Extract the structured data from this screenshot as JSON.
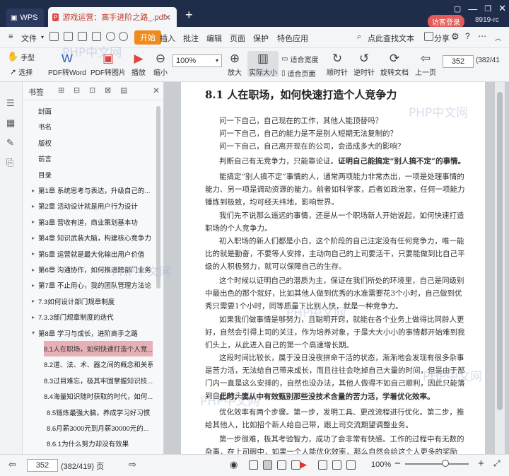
{
  "titlebar": {
    "wps_tab": "WPS",
    "doc_tab": "游戏运营：高手进阶之路_.pdf",
    "login_button": "访客登录",
    "user_id": "8919-rc"
  },
  "menubar": {
    "file": "文件",
    "items": [
      "开始",
      "插入",
      "批注",
      "编辑",
      "页面",
      "保护",
      "特色应用"
    ],
    "search": "点此查找文本",
    "share": "分享"
  },
  "toolbar": {
    "hand": "手型",
    "select": "选择",
    "pdf_to_word": "PDF转Word",
    "pdf_to_image": "PDF转图片",
    "play": "播放",
    "zoom_out": "缩小",
    "zoom_value": "100%",
    "zoom_in": "放大",
    "actual_size": "实际大小",
    "fit_width": "适合宽度",
    "fit_page": "适合页面",
    "rotate_cw": "顺时针",
    "rotate_ccw": "逆时针",
    "rotate_doc": "旋转文档",
    "prev_page": "上一页",
    "page_input": "352",
    "page_total": "(382/41"
  },
  "panel": {
    "title": "书签",
    "bookmarks": [
      {
        "label": "封面",
        "arrow": false
      },
      {
        "label": "书名",
        "arrow": false
      },
      {
        "label": "版权",
        "arrow": false
      },
      {
        "label": "前言",
        "arrow": false
      },
      {
        "label": "目录",
        "arrow": false
      },
      {
        "label": "第1章  系统思考与表达，升级自己的...",
        "arrow": true
      },
      {
        "label": "第2章  活动设计就是用户行为设计",
        "arrow": true
      },
      {
        "label": "第3章  营收有道，商业策划基本功",
        "arrow": true
      },
      {
        "label": "第4章  知识武装大脑，构建核心竞争力",
        "arrow": true
      },
      {
        "label": "第5章  运营就是最大化输出用户价值",
        "arrow": true
      },
      {
        "label": "第6章  沟通协作，如何推进跨部门业务",
        "arrow": true
      },
      {
        "label": "第7章  不止用心，我的团队管理方法论",
        "arrow": true
      },
      {
        "label": "7.3如何设计部门规章制度",
        "arrow": true
      },
      {
        "label": "7.3.3部门规章制度的迭代",
        "arrow": true
      },
      {
        "label": "第8章  学习与成长，进阶高手之路",
        "arrow": true,
        "open": true
      },
      {
        "label": "8.1人在职场，如何快速打造个人竞...",
        "arrow": false,
        "sub": true,
        "selected": true
      },
      {
        "label": "8.2道、法、术、器之间的概念和关系",
        "arrow": false,
        "sub": true
      },
      {
        "label": "8.3过目难忘，极其牢固掌握知识技...",
        "arrow": false,
        "sub": true
      },
      {
        "label": "8.4海量知识随时获取的时代，如何...",
        "arrow": false,
        "sub": true
      },
      {
        "label": "8.5锻炼最强大脑，养成学习好习惯",
        "arrow": false,
        "sub": true
      },
      {
        "label": "8.6月薪3000元到月薪30000元的...",
        "arrow": false,
        "sub": true
      },
      {
        "label": "8.6.1为什么努力却没有效果",
        "arrow": false,
        "sub": true
      }
    ]
  },
  "page": {
    "heading": "8.1    人在职场，如何快速打造个人竞争力",
    "questions": [
      "问一下自己，自己现在的工作，其他人能顶替吗？",
      "问一下自己，自己的能力是不是别人短期无法复制的？",
      "问一下自己，自己离开现在的公司，会造成多大的影响？"
    ],
    "p1a": "判断自己有无竞争力，只能靠论证。",
    "p1b": "证明自己能搞定“别人搞不定”的事情。",
    "p2": "能搞定“别人搞不定”事情的人，通常两项能力非常杰出，一项是处理事情的能力、另一项是调动资源的能力。前者如科学家，后者如政治家，任何一项能力锤炼到极致，均可经天纬地，影响世界。",
    "p3": "我们先不说那么遥远的事情，还是从一个职场新人开始说起，如何快速打造职场的个人竞争力。",
    "p4": "初入职场的新人们都是小白，这个阶段的自己注定没有任何竞争力，唯一能比的就是勤奋，不要等人安排，主动向自己的上司要活干，只要能做到比自己平级的人积极努力，就可以保障自己的生存。",
    "p5": "这个时候以证明自己的潜质为主，保证在我们所处的环境里，自己是同级别中最出色的那个就好，比如其他人做到优秀的水准需要花3个小时，自己做到优秀只需要1个小时，同等质量下比别人快，就是一种竞争力。",
    "p6": "如果我们做事情是够努力，且聪明开窍，就能在各个业务上做得比同龄人更好，自然会引得上司的关注，作为培养对象，于是大大小小的事情都开始难到我们头上，从此进入自己的第一个高速增长期。",
    "p7": "这段时间比较长，属于没日没夜拼命干活的状态，渐渐地会发现有很多杂事是苦力活，无法给自己带来成长，而且往往会吃掉自己大量的时间，但是由于部门内一直是这么安排的，自然也没办法，其他人做得不如自己顺利，因此只能落到自己的头上。",
    "p8": "此时，要从中有效甄别那些没技术含量的苦力活，学着优化效率。",
    "p9": "优化效率有两个步骤。第一步，发明工具、更改流程进行优化。第二步，推给其他人，比如招个新人给自己带，跟上司交流期望调整业务。",
    "p10": "第一步很难，极其考验智力，成功了会非常有快感。工作的过程中有无数的杂事，在上司眼中，如果一个人能优化效率，那么自然会给这个人更多的奖励（比如升职加"
  },
  "statusbar": {
    "page_input": "352",
    "page_total": "(382/419) 页",
    "zoom": "100%"
  },
  "watermark": "PHP中文网"
}
